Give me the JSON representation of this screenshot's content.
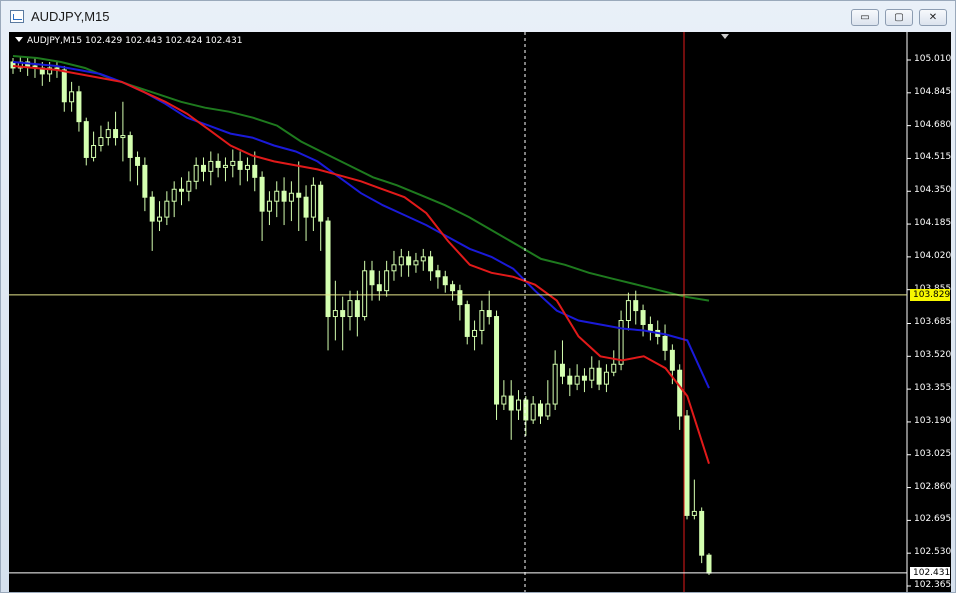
{
  "window": {
    "title": "AUDJPY,M15",
    "minimize_glyph": "▭",
    "maximize_glyph": "▢",
    "close_glyph": "✕"
  },
  "chart": {
    "symbol_line": "AUDJPY,M15  102.429 102.443 102.424 102.431",
    "bid_price_tag": "103.829",
    "current_price_tag": "102.431",
    "colors": {
      "background": "#000000",
      "candle": "#d4ffb0",
      "ma_fast": "#e11a1a",
      "ma_mid": "#1a1ad8",
      "ma_slow": "#1e7a1e",
      "crosshair": "#ffffff",
      "price_line": "#e6e68c",
      "period_separator": "#e11a1a"
    }
  },
  "chart_data": {
    "type": "candlestick",
    "y_axis_ticks": [
      "105.010",
      "104.845",
      "104.680",
      "104.515",
      "104.350",
      "104.185",
      "104.020",
      "103.855",
      "103.685",
      "103.520",
      "103.355",
      "103.190",
      "103.025",
      "102.860",
      "102.695",
      "102.530",
      "102.365"
    ],
    "ylim": [
      102.365,
      105.01
    ],
    "candles": [
      [
        105.0,
        104.97,
        105.02,
        104.94
      ],
      [
        104.97,
        105.0,
        105.03,
        104.95
      ],
      [
        105.0,
        104.98,
        105.02,
        104.93
      ],
      [
        104.98,
        104.97,
        105.02,
        104.92
      ],
      [
        104.97,
        104.94,
        105.0,
        104.88
      ],
      [
        104.94,
        104.97,
        105.0,
        104.9
      ],
      [
        104.97,
        104.96,
        105.0,
        104.92
      ],
      [
        104.96,
        104.8,
        104.98,
        104.75
      ],
      [
        104.8,
        104.85,
        104.9,
        104.75
      ],
      [
        104.85,
        104.7,
        104.88,
        104.65
      ],
      [
        104.7,
        104.52,
        104.72,
        104.48
      ],
      [
        104.52,
        104.58,
        104.65,
        104.5
      ],
      [
        104.58,
        104.62,
        104.68,
        104.55
      ],
      [
        104.62,
        104.66,
        104.7,
        104.58
      ],
      [
        104.66,
        104.62,
        104.75,
        104.58
      ],
      [
        104.62,
        104.63,
        104.8,
        104.5
      ],
      [
        104.63,
        104.52,
        104.65,
        104.4
      ],
      [
        104.52,
        104.48,
        104.55,
        104.38
      ],
      [
        104.48,
        104.32,
        104.52,
        104.25
      ],
      [
        104.32,
        104.2,
        104.35,
        104.05
      ],
      [
        104.2,
        104.22,
        104.3,
        104.15
      ],
      [
        104.22,
        104.3,
        104.35,
        104.18
      ],
      [
        104.3,
        104.36,
        104.4,
        104.22
      ],
      [
        104.36,
        104.35,
        104.42,
        104.28
      ],
      [
        104.35,
        104.4,
        104.45,
        104.3
      ],
      [
        104.4,
        104.48,
        104.52,
        104.36
      ],
      [
        104.48,
        104.45,
        104.52,
        104.4
      ],
      [
        104.45,
        104.5,
        104.55,
        104.38
      ],
      [
        104.5,
        104.47,
        104.54,
        104.42
      ],
      [
        104.47,
        104.48,
        104.52,
        104.4
      ],
      [
        104.48,
        104.5,
        104.56,
        104.42
      ],
      [
        104.5,
        104.46,
        104.55,
        104.38
      ],
      [
        104.46,
        104.48,
        104.52,
        104.4
      ],
      [
        104.48,
        104.42,
        104.55,
        104.35
      ],
      [
        104.42,
        104.25,
        104.45,
        104.1
      ],
      [
        104.25,
        104.3,
        104.35,
        104.18
      ],
      [
        104.3,
        104.35,
        104.4,
        104.22
      ],
      [
        104.35,
        104.3,
        104.42,
        104.18
      ],
      [
        104.3,
        104.34,
        104.4,
        104.2
      ],
      [
        104.34,
        104.32,
        104.5,
        104.15
      ],
      [
        104.32,
        104.22,
        104.38,
        104.1
      ],
      [
        104.22,
        104.38,
        104.42,
        104.15
      ],
      [
        104.38,
        104.2,
        104.4,
        104.05
      ],
      [
        104.2,
        103.72,
        104.22,
        103.55
      ],
      [
        103.72,
        103.75,
        103.9,
        103.6
      ],
      [
        103.75,
        103.72,
        103.82,
        103.55
      ],
      [
        103.72,
        103.8,
        103.85,
        103.65
      ],
      [
        103.8,
        103.72,
        103.85,
        103.62
      ],
      [
        103.72,
        103.95,
        104.0,
        103.7
      ],
      [
        103.95,
        103.88,
        104.0,
        103.8
      ],
      [
        103.88,
        103.85,
        103.95,
        103.8
      ],
      [
        103.85,
        103.95,
        104.0,
        103.82
      ],
      [
        103.95,
        103.98,
        104.05,
        103.9
      ],
      [
        103.98,
        104.02,
        104.06,
        103.92
      ],
      [
        104.02,
        103.98,
        104.05,
        103.92
      ],
      [
        103.98,
        104.0,
        104.04,
        103.94
      ],
      [
        104.0,
        104.02,
        104.06,
        103.95
      ],
      [
        104.02,
        103.95,
        104.05,
        103.9
      ],
      [
        103.95,
        103.92,
        103.98,
        103.86
      ],
      [
        103.92,
        103.88,
        103.95,
        103.84
      ],
      [
        103.88,
        103.85,
        103.9,
        103.8
      ],
      [
        103.85,
        103.78,
        103.88,
        103.7
      ],
      [
        103.78,
        103.62,
        103.8,
        103.58
      ],
      [
        103.62,
        103.65,
        103.7,
        103.55
      ],
      [
        103.65,
        103.75,
        103.8,
        103.58
      ],
      [
        103.75,
        103.72,
        103.85,
        103.68
      ],
      [
        103.72,
        103.28,
        103.75,
        103.2
      ],
      [
        103.28,
        103.32,
        103.4,
        103.25
      ],
      [
        103.32,
        103.25,
        103.4,
        103.1
      ],
      [
        103.25,
        103.3,
        103.35,
        103.2
      ],
      [
        103.3,
        103.2,
        103.32,
        103.12
      ],
      [
        103.2,
        103.28,
        103.32,
        103.18
      ],
      [
        103.28,
        103.22,
        103.3,
        103.18
      ],
      [
        103.22,
        103.28,
        103.4,
        103.2
      ],
      [
        103.28,
        103.48,
        103.55,
        103.25
      ],
      [
        103.48,
        103.42,
        103.6,
        103.38
      ],
      [
        103.42,
        103.38,
        103.46,
        103.32
      ],
      [
        103.38,
        103.42,
        103.48,
        103.35
      ],
      [
        103.42,
        103.4,
        103.46,
        103.34
      ],
      [
        103.4,
        103.46,
        103.52,
        103.36
      ],
      [
        103.46,
        103.38,
        103.5,
        103.35
      ],
      [
        103.38,
        103.44,
        103.48,
        103.34
      ],
      [
        103.44,
        103.48,
        103.55,
        103.42
      ],
      [
        103.48,
        103.7,
        103.75,
        103.45
      ],
      [
        103.7,
        103.8,
        103.84,
        103.65
      ],
      [
        103.8,
        103.75,
        103.85,
        103.68
      ],
      [
        103.75,
        103.68,
        103.78,
        103.62
      ],
      [
        103.68,
        103.65,
        103.72,
        103.6
      ],
      [
        103.65,
        103.62,
        103.7,
        103.58
      ],
      [
        103.62,
        103.55,
        103.68,
        103.5
      ],
      [
        103.55,
        103.45,
        103.58,
        103.38
      ],
      [
        103.45,
        103.22,
        103.48,
        103.15
      ],
      [
        103.22,
        102.72,
        103.25,
        102.7
      ],
      [
        102.72,
        102.74,
        102.9,
        102.7
      ],
      [
        102.74,
        102.52,
        102.76,
        102.48
      ],
      [
        102.52,
        102.43,
        102.53,
        102.42
      ]
    ],
    "ma_fast": [
      104.98,
      104.97,
      104.96,
      104.94,
      104.92,
      104.9,
      104.85,
      104.8,
      104.74,
      104.66,
      104.58,
      104.53,
      104.5,
      104.48,
      104.46,
      104.43,
      104.4,
      104.36,
      104.32,
      104.24,
      104.1,
      103.98,
      103.94,
      103.92,
      103.88,
      103.8,
      103.62,
      103.52,
      103.5,
      103.52,
      103.46,
      103.32,
      102.98
    ],
    "ma_mid": [
      105.0,
      104.99,
      104.98,
      104.96,
      104.94,
      104.9,
      104.85,
      104.79,
      104.72,
      104.68,
      104.64,
      104.62,
      104.58,
      104.55,
      104.5,
      104.42,
      104.34,
      104.28,
      104.23,
      104.18,
      104.12,
      104.06,
      104.02,
      103.96,
      103.85,
      103.75,
      103.7,
      103.68,
      103.66,
      103.65,
      103.63,
      103.6,
      103.36
    ],
    "ma_slow": [
      105.03,
      105.02,
      105.0,
      104.97,
      104.92,
      104.88,
      104.84,
      104.8,
      104.77,
      104.75,
      104.72,
      104.68,
      104.6,
      104.54,
      104.48,
      104.42,
      104.38,
      104.33,
      104.28,
      104.22,
      104.15,
      104.08,
      104.01,
      103.98,
      103.94,
      103.91,
      103.88,
      103.85,
      103.82,
      103.8
    ]
  }
}
